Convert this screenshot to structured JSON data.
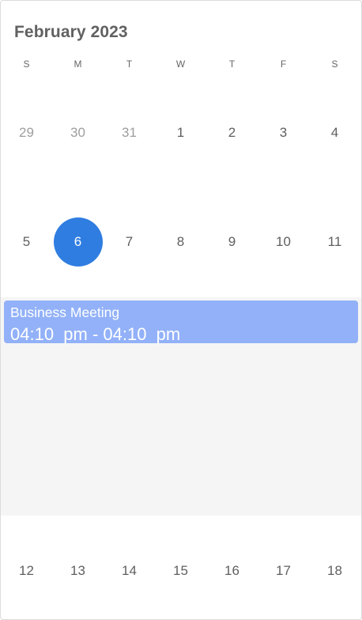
{
  "calendar": {
    "title": "February 2023",
    "weekdays": [
      "S",
      "M",
      "T",
      "W",
      "T",
      "F",
      "S"
    ],
    "weeks": [
      [
        {
          "day": "29",
          "muted": true
        },
        {
          "day": "30",
          "muted": true
        },
        {
          "day": "31",
          "muted": true
        },
        {
          "day": "1"
        },
        {
          "day": "2"
        },
        {
          "day": "3"
        },
        {
          "day": "4"
        }
      ],
      [
        {
          "day": "5"
        },
        {
          "day": "6",
          "selected": true
        },
        {
          "day": "7"
        },
        {
          "day": "8"
        },
        {
          "day": "9"
        },
        {
          "day": "10"
        },
        {
          "day": "11"
        }
      ],
      [
        {
          "day": "12"
        },
        {
          "day": "13"
        },
        {
          "day": "14"
        },
        {
          "day": "15"
        },
        {
          "day": "16"
        },
        {
          "day": "17"
        },
        {
          "day": "18"
        }
      ]
    ]
  },
  "agenda": {
    "events": [
      {
        "title": "Business Meeting",
        "time": "04:10  pm - 04:10  pm"
      }
    ]
  },
  "colors": {
    "selected_day": "#2f7de1",
    "event_background": "#92b1f8",
    "agenda_background": "#f5f5f5"
  }
}
